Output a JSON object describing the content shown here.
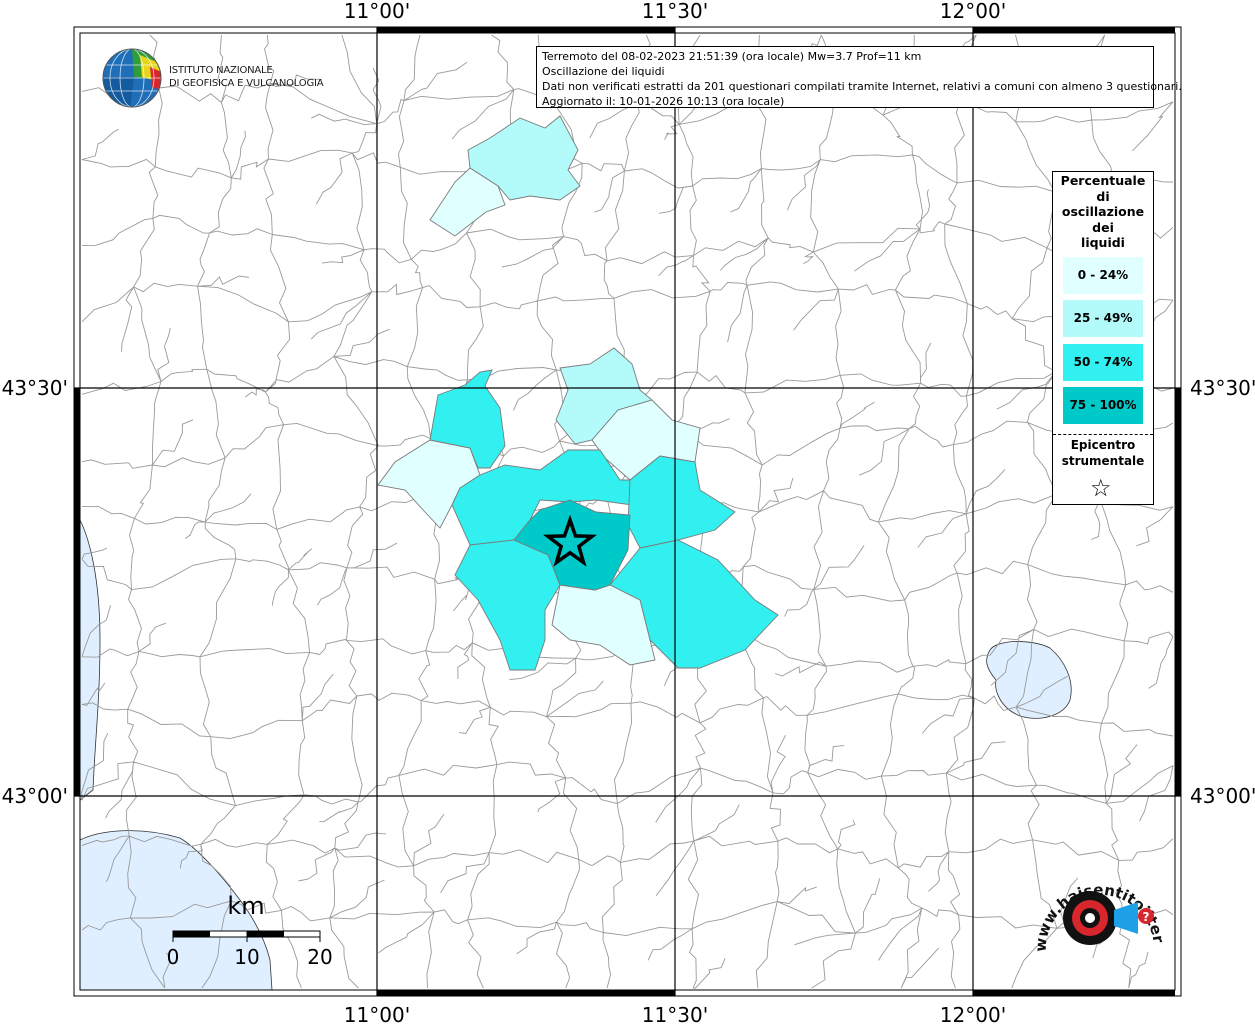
{
  "info_box": {
    "line1": "Terremoto del 08-02-2023 21:51:39 (ora locale) Mw=3.7 Prof=11 km",
    "line2": "Oscillazione dei liquidi",
    "line3": "Dati non verificati estratti da 201 questionari compilati tramite Internet, relativi a comuni con almeno 3 questionari.",
    "line4": "Aggiornato il: 10-01-2026 10:13 (ora locale)"
  },
  "legend": {
    "title_lines": [
      "Percentuale",
      "di",
      "oscillazione",
      "dei",
      "liquidi"
    ],
    "items": [
      {
        "label": "0 - 24%",
        "color": "#e0ffff"
      },
      {
        "label": "25 - 49%",
        "color": "#b3fafa"
      },
      {
        "label": "50 - 74%",
        "color": "#33f0f0"
      },
      {
        "label": "75 - 100%",
        "color": "#00c9c9"
      }
    ],
    "epicenter_lines": [
      "Epicentro",
      "strumentale"
    ],
    "epicenter_symbol": "☆"
  },
  "axes": {
    "top_labels": [
      "11°00'",
      "11°30'",
      "12°00'"
    ],
    "bottom_labels": [
      "11°00'",
      "11°30'",
      "12°00'"
    ],
    "left_labels": [
      "43°30'",
      "43°00'"
    ],
    "right_labels": [
      "43°30'",
      "43°00'"
    ]
  },
  "scale_bar": {
    "unit": "km",
    "ticks": [
      "0",
      "10",
      "20"
    ]
  },
  "logo_ingv": {
    "line1": "ISTITUTO NAZIONALE",
    "line2": "DI GEOFISICA E VULCANOLOGIA"
  },
  "logo_hst": {
    "text": "www.haisentitoilterremoto.it"
  },
  "colors": {
    "sea": "#dfefff",
    "border": "#9a9a9a",
    "grid": "#000000",
    "epicenter": "#000000"
  }
}
